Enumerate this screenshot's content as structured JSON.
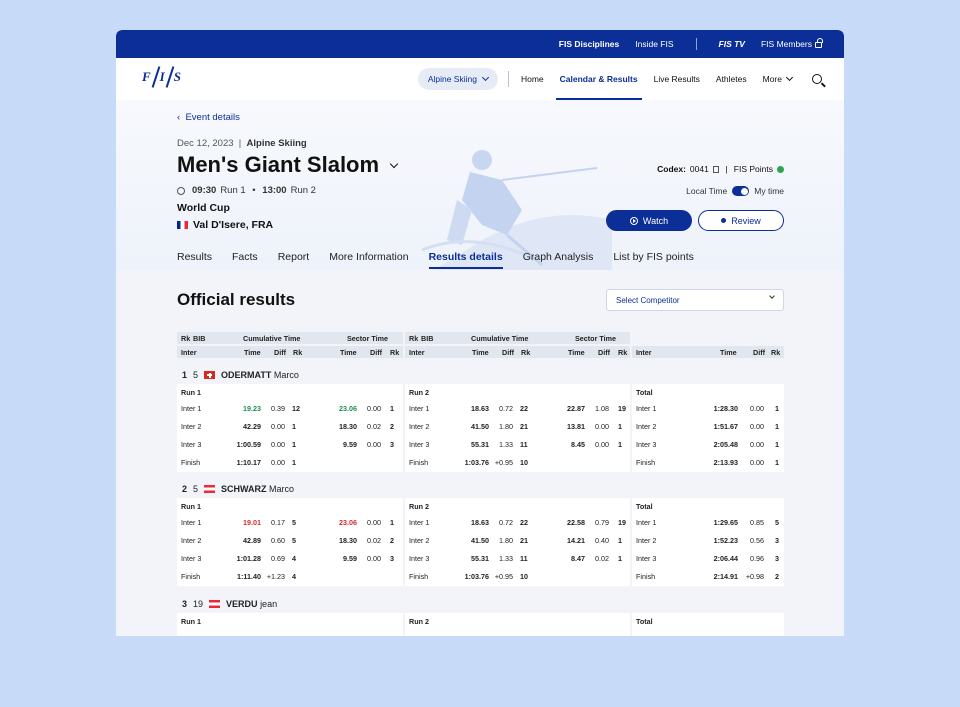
{
  "topbar": {
    "disciplines": "FIS Disciplines",
    "inside": "Inside FIS",
    "tv": "FIS TV",
    "members": "FIS Members"
  },
  "nav": {
    "logo": "FIS",
    "discipline_pill": "Alpine Skiing",
    "links": [
      "Home",
      "Calendar & Results",
      "Live Results",
      "Athletes",
      "More"
    ]
  },
  "event": {
    "back": "Event details",
    "date": "Dec 12, 2023",
    "discipline": "Alpine Skiing",
    "title": "Men's Giant Slalom",
    "run1_time": "09:30",
    "run1_label": "Run 1",
    "run2_time": "13:00",
    "run2_label": "Run 2",
    "cup": "World Cup",
    "venue": "Val D'Isere, FRA",
    "codex_label": "Codex:",
    "codex_value": "0041",
    "fis_points": "FIS Points",
    "local_time": "Local Time",
    "my_time": "My time",
    "watch": "Watch",
    "review": "Review"
  },
  "tabs": [
    "Results",
    "Facts",
    "Report",
    "More Information",
    "Results details",
    "Graph Analysis",
    "List by FIS points"
  ],
  "results": {
    "heading": "Official results",
    "select_placeholder": "Select Competitor",
    "headers": {
      "rk": "Rk",
      "bib": "BIB",
      "cumulative": "Cumulative Time",
      "sector": "Sector Time",
      "inter": "Inter",
      "time": "Time",
      "diff": "Diff"
    },
    "panel_titles": [
      "Run 1",
      "Run 2",
      "Total"
    ],
    "athletes": [
      {
        "rank": "1",
        "bib": "5",
        "surname": "ODERMATT",
        "first": "Marco",
        "flag": "SUI",
        "run1": [
          [
            "Inter 1",
            "19.23",
            "0.39",
            "12",
            "23.06",
            "0.00",
            "1"
          ],
          [
            "Inter 2",
            "42.29",
            "0.00",
            "1",
            "18.30",
            "0.02",
            "2"
          ],
          [
            "Inter 3",
            "1:00.59",
            "0.00",
            "1",
            "9.59",
            "0.00",
            "3"
          ],
          [
            "Finish",
            "1:10.17",
            "0.00",
            "1",
            "",
            "",
            ""
          ]
        ],
        "run2": [
          [
            "Inter 1",
            "18.63",
            "0.72",
            "22",
            "22.87",
            "1.08",
            "19"
          ],
          [
            "Inter 2",
            "41.50",
            "1.80",
            "21",
            "13.81",
            "0.00",
            "1"
          ],
          [
            "Inter 3",
            "55.31",
            "1.33",
            "11",
            "8.45",
            "0.00",
            "1"
          ],
          [
            "Finish",
            "1:03.76",
            "+0.95",
            "10",
            "",
            "",
            ""
          ]
        ],
        "total": [
          [
            "Inter 1",
            "1:28.30",
            "0.00",
            "1"
          ],
          [
            "Inter 2",
            "1:51.67",
            "0.00",
            "1"
          ],
          [
            "Inter 3",
            "2:05.48",
            "0.00",
            "1"
          ],
          [
            "Finish",
            "2:13.93",
            "0.00",
            "1"
          ]
        ]
      },
      {
        "rank": "2",
        "bib": "5",
        "surname": "SCHWARZ",
        "first": "Marco",
        "flag": "AUT",
        "run1": [
          [
            "Inter 1",
            "19.01",
            "0.17",
            "5",
            "23.06",
            "0.00",
            "1"
          ],
          [
            "Inter 2",
            "42.89",
            "0.60",
            "5",
            "18.30",
            "0.02",
            "2"
          ],
          [
            "Inter 3",
            "1:01.28",
            "0.69",
            "4",
            "9.59",
            "0.00",
            "3"
          ],
          [
            "Finish",
            "1:11.40",
            "+1.23",
            "4",
            "",
            "",
            ""
          ]
        ],
        "run2": [
          [
            "Inter 1",
            "18.63",
            "0.72",
            "22",
            "22.58",
            "0.79",
            "19"
          ],
          [
            "Inter 2",
            "41.50",
            "1.80",
            "21",
            "14.21",
            "0.40",
            "1"
          ],
          [
            "Inter 3",
            "55.31",
            "1.33",
            "11",
            "8.47",
            "0.02",
            "1"
          ],
          [
            "Finish",
            "1:03.76",
            "+0.95",
            "10",
            "",
            "",
            ""
          ]
        ],
        "total": [
          [
            "Inter 1",
            "1:29.65",
            "0.85",
            "5"
          ],
          [
            "Inter 2",
            "1:52.23",
            "0.56",
            "3"
          ],
          [
            "Inter 3",
            "2:06.44",
            "0.96",
            "3"
          ],
          [
            "Finish",
            "2:14.91",
            "+0.98",
            "2"
          ]
        ]
      },
      {
        "rank": "3",
        "bib": "19",
        "surname": "VERDU",
        "first": "jean",
        "flag": "AUT"
      }
    ]
  },
  "colors": {
    "brand": "#0c2f97",
    "green": "#1d8f4f",
    "red": "#d12c2c"
  }
}
